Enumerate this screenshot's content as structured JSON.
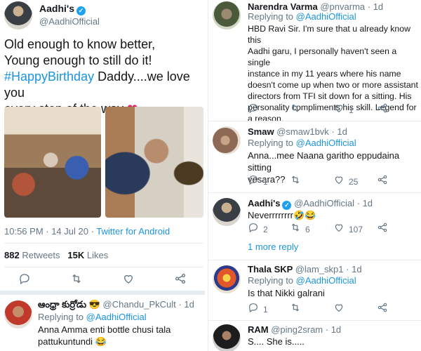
{
  "main_tweet": {
    "author_name": "Aadhi's",
    "handle": "@AadhiOfficial",
    "text_line1": "Old enough to know better,",
    "text_line2": "Young enough to still do it!",
    "hashtag": "#HappyBirthday",
    "text_line3_rest": " Daddy....we love you",
    "text_line4": "every step of the way",
    "heart": "❤",
    "time": "10:56 PM · 14 Jul 20 · ",
    "source": "Twitter for Android",
    "retweets_count": "882",
    "retweets_label": "Retweets",
    "likes_count": "15K",
    "likes_label": "Likes",
    "icons": [
      "reply-icon",
      "retweet-icon",
      "like-icon",
      "share-icon"
    ]
  },
  "left_reply": {
    "author_name": "ఆంధ్రా కుర్రోడు 😎",
    "handle": "@Chandu_PkCult",
    "age": "· 1d",
    "replying_prefix": "Replying to ",
    "replying_to": "@AadhiOfficial",
    "text_line1": "Anna Amma enti  bottle chusi tala",
    "text_line2": "pattukuntundi 😂"
  },
  "right_replies": [
    {
      "author_name": "Narendra Varma",
      "handle": "@pnvarma",
      "age": "· 1d",
      "replying_prefix": "Replying to ",
      "replying_to": "@AadhiOfficial",
      "text_lines": [
        "HBD Ravi Sir. I'm sure that u already know this",
        "Aadhi garu, I personally haven't seen a single",
        "instance in my 11 years where his name",
        "doesn't come up when two or more assistant",
        "directors from TFI sit down for a sitting. His",
        "personality compliments his skill. Legend for",
        "a reason."
      ],
      "reply_count": "",
      "retweet_count": "",
      "like_count": "1"
    },
    {
      "author_name": "Smaw",
      "handle": "@smaw1bvk",
      "age": "· 1d",
      "replying_prefix": "Replying to ",
      "replying_to": "@AadhiOfficial",
      "text_lines": [
        "Anna...mee Naana garitho eppudaina sitting",
        "vesara??"
      ],
      "reply_count": "1",
      "retweet_count": "",
      "like_count": "25"
    },
    {
      "author_name": "Aadhi's",
      "handle": "@AadhiOfficial",
      "age": "· 1d",
      "text_lines": [
        "Neverrrrrrrr🤣😂"
      ],
      "reply_count": "2",
      "retweet_count": "6",
      "like_count": "107",
      "more_replies": "1 more reply"
    },
    {
      "author_name": "Thala SKP",
      "handle": "@lam_skp1",
      "age": "· 1d",
      "replying_prefix": "Replying to ",
      "replying_to": "@AadhiOfficial",
      "text_lines": [
        "Is that Nikki galrani"
      ],
      "reply_count": "1",
      "retweet_count": "",
      "like_count": ""
    },
    {
      "author_name": "RAM",
      "handle": "@ping2sram",
      "age": "· 1d",
      "text_lines": [
        "S.... She is....."
      ]
    }
  ],
  "colors": {
    "link_blue": "#1b95e0",
    "verified_blue": "#1da1f2",
    "muted_gray": "#657786",
    "heart_red": "#e0245e",
    "divider": "#e6ecf0"
  }
}
